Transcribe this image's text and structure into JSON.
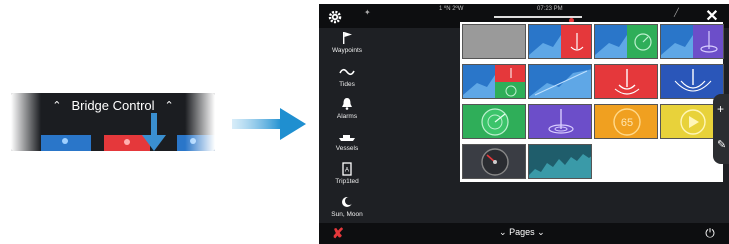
{
  "bridge_control": {
    "label": "Bridge Control",
    "chev_left": "⌃",
    "chev_right": "⌃"
  },
  "statusbar": {
    "position_text": "1 ºN 2ºW",
    "time_text": "07:23 PM",
    "close_label": "✕"
  },
  "sidebar": {
    "items": [
      {
        "label": "Waypoints",
        "icon": "flag-icon"
      },
      {
        "label": "Tides",
        "icon": "wave-icon"
      },
      {
        "label": "Alarms",
        "icon": "bell-icon"
      },
      {
        "label": "Vessels",
        "icon": "boat-icon"
      },
      {
        "label": "Trip1ted",
        "icon": "trip-icon"
      },
      {
        "label": "Sun, Moon",
        "icon": "moon-icon"
      }
    ]
  },
  "tiles": {
    "t11": "65"
  },
  "bottombar": {
    "pages_label": "Pages",
    "pages_chevron_left": "⌄",
    "pages_chevron_right": "⌄",
    "left_icon": "✘",
    "power_icon": "⏻"
  },
  "side_buttons": {
    "plus": "+",
    "pen": "✎"
  },
  "colors": {
    "blue": "#2a76c9",
    "red": "#e5383b",
    "green": "#2fae59",
    "purple": "#6c4ec9",
    "orange": "#f0a020",
    "yellow": "#e8d23a",
    "gray": "#9a9a9a",
    "dark": "#1e2024"
  }
}
